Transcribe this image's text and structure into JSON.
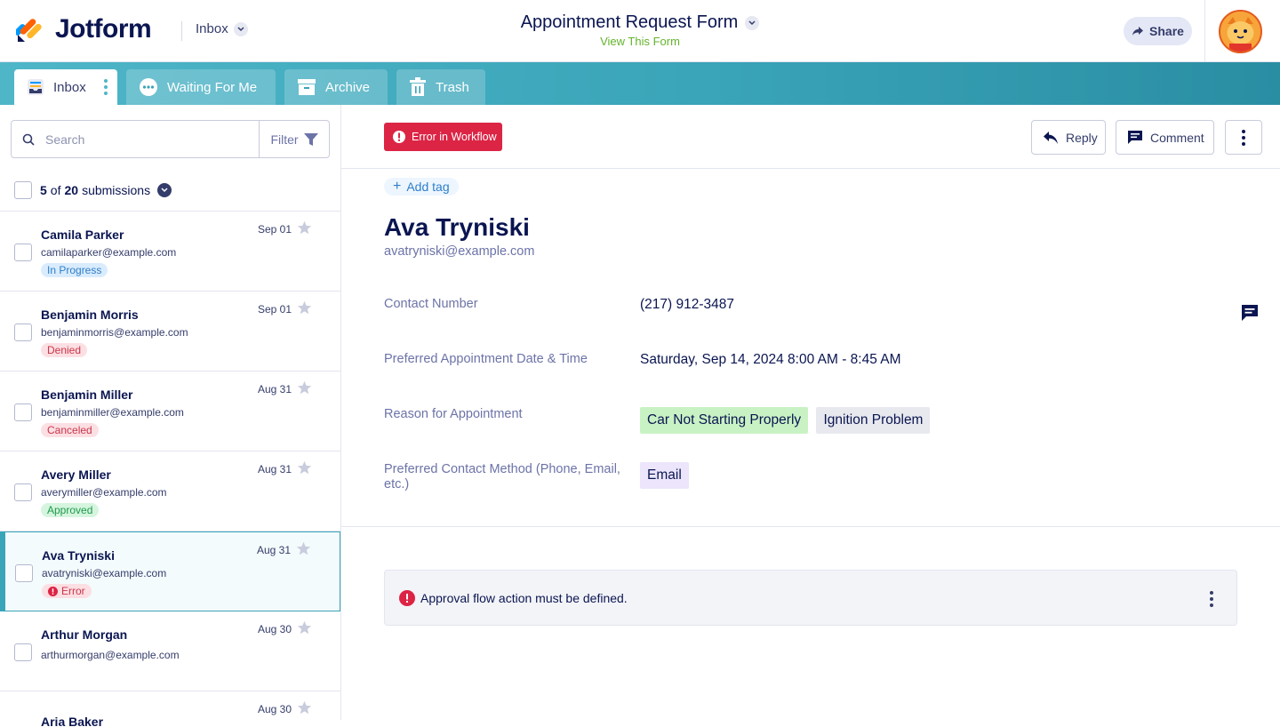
{
  "header": {
    "logo_text": "Jotform",
    "inbox_label": "Inbox",
    "form_title": "Appointment Request Form",
    "view_form_link": "View This Form",
    "share_label": "Share"
  },
  "tabs": [
    {
      "label": "Inbox",
      "icon": "inbox-icon",
      "active": true
    },
    {
      "label": "Waiting For Me",
      "icon": "dots-circle-icon",
      "active": false
    },
    {
      "label": "Archive",
      "icon": "archive-icon",
      "active": false
    },
    {
      "label": "Trash",
      "icon": "trash-icon",
      "active": false
    }
  ],
  "sidebar": {
    "search_placeholder": "Search",
    "filter_label": "Filter",
    "count_shown": "5",
    "count_of": "of",
    "count_total": "20",
    "count_suffix": "submissions",
    "submissions": [
      {
        "name": "Camila Parker",
        "email": "camilaparker@example.com",
        "date": "Sep 01",
        "status": "In Progress",
        "status_kind": "progress"
      },
      {
        "name": "Benjamin Morris",
        "email": "benjaminmorris@example.com",
        "date": "Sep 01",
        "status": "Denied",
        "status_kind": "denied"
      },
      {
        "name": "Benjamin Miller",
        "email": "benjaminmiller@example.com",
        "date": "Aug 31",
        "status": "Canceled",
        "status_kind": "canceled"
      },
      {
        "name": "Avery Miller",
        "email": "averymiller@example.com",
        "date": "Aug 31",
        "status": "Approved",
        "status_kind": "approved"
      },
      {
        "name": "Ava Tryniski",
        "email": "avatryniski@example.com",
        "date": "Aug 31",
        "status": "Error",
        "status_kind": "error",
        "selected": true
      },
      {
        "name": "Arthur Morgan",
        "email": "arthurmorgan@example.com",
        "date": "Aug 30",
        "status": "",
        "status_kind": ""
      },
      {
        "name": "Aria Baker",
        "email": "",
        "date": "Aug 30",
        "status": "",
        "status_kind": ""
      }
    ]
  },
  "detail": {
    "error_badge": "Error in Workflow",
    "reply_label": "Reply",
    "comment_label": "Comment",
    "add_tag_label": "Add tag",
    "name": "Ava Tryniski",
    "email": "avatryniski@example.com",
    "fields": [
      {
        "label": "Contact Number",
        "value": "(217) 912-3487"
      },
      {
        "label": "Preferred Appointment Date & Time",
        "value": "Saturday, Sep 14, 2024 8:00 AM - 8:45 AM"
      },
      {
        "label": "Reason for Appointment",
        "chips": [
          "Car Not Starting Properly",
          "Ignition Problem"
        ]
      },
      {
        "label": "Preferred Contact Method (Phone, Email, etc.)",
        "chips": [
          "Email"
        ]
      }
    ],
    "alert_message": "Approval flow action must be defined."
  },
  "colors": {
    "brand_navy": "#0a1551",
    "tab_teal": "#3aa4b8",
    "error_red": "#dc2445",
    "link_green": "#64b32b"
  }
}
